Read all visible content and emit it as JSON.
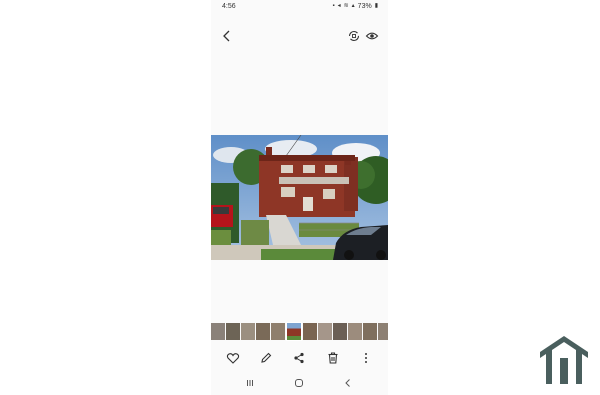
{
  "status_bar": {
    "time": "4:56",
    "battery": "73%"
  },
  "icons": {
    "back": "chevron-left-icon",
    "rotate": "rotate-icon",
    "view": "eye-icon",
    "favorite": "heart-icon",
    "edit": "pencil-icon",
    "share": "share-icon",
    "delete": "trash-icon",
    "more": "more-vertical-icon",
    "recents": "recent-apps-icon",
    "home": "home-circle-icon",
    "nav_back": "nav-back-icon",
    "logo": "house-logo"
  },
  "thumbnails": {
    "count": 12,
    "selected_index": 5
  },
  "colors": {
    "background": "#ffffff",
    "phone_background": "#fafafa",
    "icon": "#333333",
    "logo": "#4a5f5e"
  }
}
